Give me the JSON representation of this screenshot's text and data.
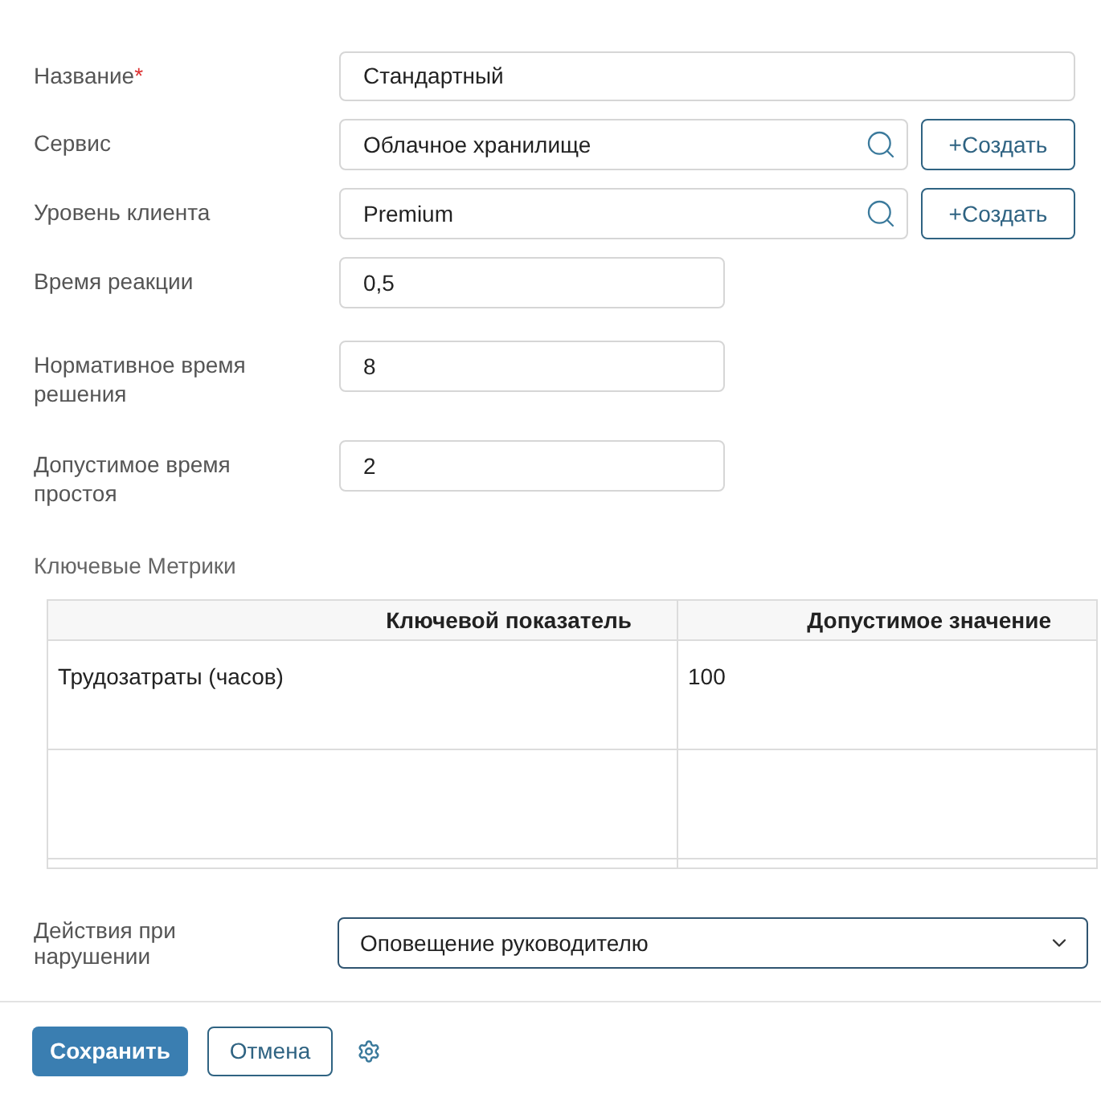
{
  "fields": [
    {
      "kind": "text",
      "label": "Название",
      "required_mark": "*",
      "value": "Стандартный"
    },
    {
      "kind": "lookup",
      "label": "Сервис",
      "value": "Облачное хранилище",
      "create_label": "+Создать"
    },
    {
      "kind": "lookup",
      "label": "Уровень клиента",
      "value": "Premium",
      "create_label": "+Создать"
    },
    {
      "kind": "number",
      "label": "Время реакции",
      "value": "0,5"
    },
    {
      "kind": "number",
      "label": "Нормативное время решения",
      "value": "8"
    },
    {
      "kind": "number",
      "label": "Допустимое время простоя",
      "value": "2"
    }
  ],
  "metrics": {
    "title": "Ключевые Метрики",
    "columns": [
      "Ключевой показатель",
      "Допустимое значение"
    ],
    "rows": [
      [
        "Трудозатраты (часов)",
        "100"
      ],
      [
        "",
        ""
      ]
    ]
  },
  "violation": {
    "label": "Действия при нарушении",
    "value": "Оповещение руководителю"
  },
  "buttons": {
    "save": "Сохранить",
    "cancel": "Отмена"
  }
}
